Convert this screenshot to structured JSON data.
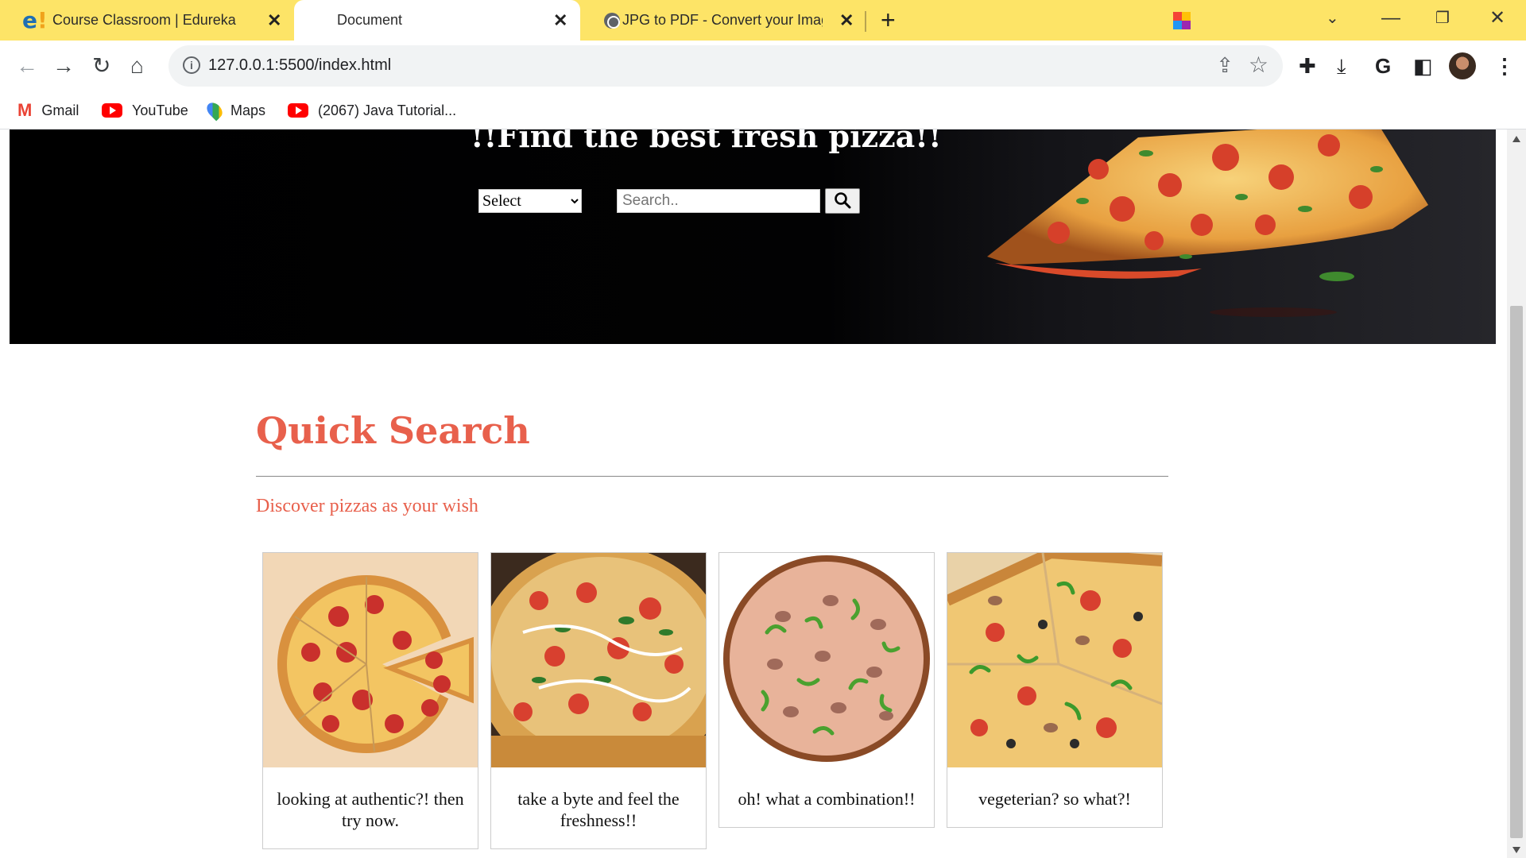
{
  "browser": {
    "tabs": [
      {
        "title": "Course Classroom | Edureka",
        "active": false
      },
      {
        "title": "Document",
        "active": true
      },
      {
        "title": "JPG to PDF - Convert your Images",
        "active": false
      }
    ],
    "url": "127.0.0.1:5500/index.html",
    "bookmarks": [
      {
        "label": "Gmail",
        "icon": "gmail-icon"
      },
      {
        "label": "YouTube",
        "icon": "youtube-icon"
      },
      {
        "label": "Maps",
        "icon": "maps-icon"
      },
      {
        "label": "(2067) Java Tutorial...",
        "icon": "youtube-icon"
      }
    ],
    "colors": {
      "tabstrip": "#fde467",
      "accent": "#e8604c"
    }
  },
  "hero": {
    "heading": "!!Find the best fresh pizza!!",
    "select_label": "Select",
    "search_placeholder": "Search.."
  },
  "quick_search": {
    "title": "Quick Search",
    "subtitle": "Discover pizzas as your wish",
    "cards": [
      {
        "caption": "looking at authentic?! then try now.",
        "image": "pepperoni pizza"
      },
      {
        "caption": "take a byte and feel the freshness!!",
        "image": "loaded pizza"
      },
      {
        "caption": "oh! what a combination!!",
        "image": "green pepper mushroom pizza"
      },
      {
        "caption": "vegeterian? so what?!",
        "image": "vegetarian pizza slices"
      }
    ]
  }
}
